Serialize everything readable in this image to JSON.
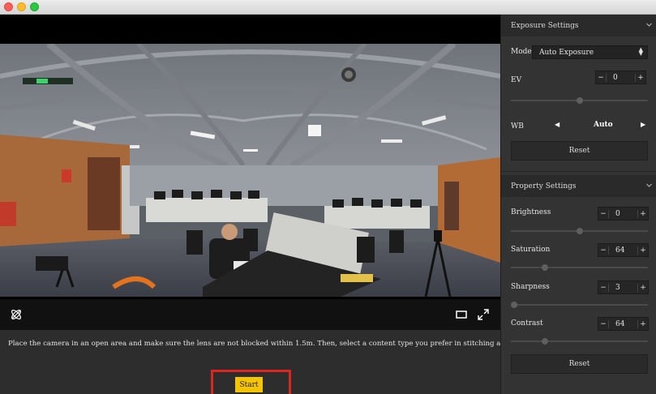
{
  "window": {
    "controls": [
      "close",
      "minimize",
      "maximize"
    ]
  },
  "preview": {
    "toolbar": {
      "left_icon": "gyro-atom-icon",
      "right_icons": [
        "aspect-ratio-icon",
        "fullscreen-icon"
      ]
    }
  },
  "instruction": {
    "text": "Place the camera in an open area and make sure the lens are not blocked within 1.5m. Then, select a content type you prefer in stitching and calibration.",
    "start_label": "Start"
  },
  "exposure": {
    "title": "Exposure Settings",
    "mode_label": "Mode",
    "mode_value": "Auto Exposure",
    "ev_label": "EV",
    "ev_value": "0",
    "ev_level": 0.5,
    "wb_label": "WB",
    "wb_value": "Auto",
    "reset_label": "Reset"
  },
  "property": {
    "title": "Property Settings",
    "brightness_label": "Brightness",
    "brightness_value": "0",
    "brightness_level": 0.5,
    "saturation_label": "Saturation",
    "saturation_value": "64",
    "saturation_level": 0.25,
    "sharpness_label": "Sharpness",
    "sharpness_value": "3",
    "sharpness_level": 0.0,
    "contrast_label": "Contrast",
    "contrast_value": "64",
    "contrast_level": 0.25,
    "reset_label": "Reset"
  },
  "colors": {
    "start_button": "#f5c400",
    "highlight_outline": "#e0241f",
    "panel_bg": "#333333"
  }
}
